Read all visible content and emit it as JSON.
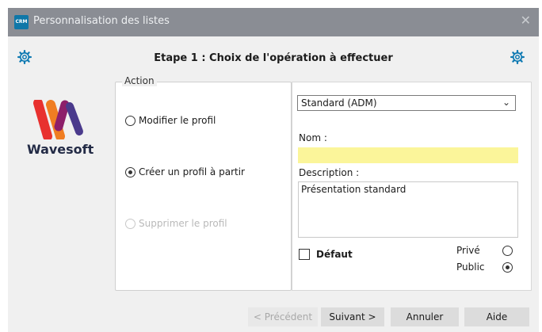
{
  "window": {
    "title": "Personnalisation des listes",
    "app_icon_text": "CRM",
    "close_glyph": "✕"
  },
  "header": {
    "step_title": "Etape 1 : Choix de l'opération à effectuer",
    "left_icon": "gear-icon",
    "right_icon": "gear-icon"
  },
  "logo": {
    "text": "Wavesoft"
  },
  "action": {
    "legend": "Action",
    "options": [
      {
        "label": "Modifier le profil",
        "selected": false,
        "enabled": true
      },
      {
        "label": "Créer un profil à partir",
        "selected": true,
        "enabled": true
      },
      {
        "label": "Supprimer le profil",
        "selected": false,
        "enabled": false
      }
    ]
  },
  "profile": {
    "selected": "Standard (ADM)",
    "nom_label": "Nom :",
    "nom_value": "",
    "description_label": "Description :",
    "description_value": "Présentation standard",
    "default_label": "Défaut",
    "default_checked": false,
    "visibility": [
      {
        "label": "Privé",
        "selected": false
      },
      {
        "label": "Public",
        "selected": true
      }
    ]
  },
  "buttons": {
    "previous": "< Précédent",
    "next": "Suivant >",
    "cancel": "Annuler",
    "help": "Aide"
  },
  "colors": {
    "highlight_input": "#fbf59a",
    "titlebar": "#8a8d94",
    "dialog_bg": "#f0f0f0"
  }
}
